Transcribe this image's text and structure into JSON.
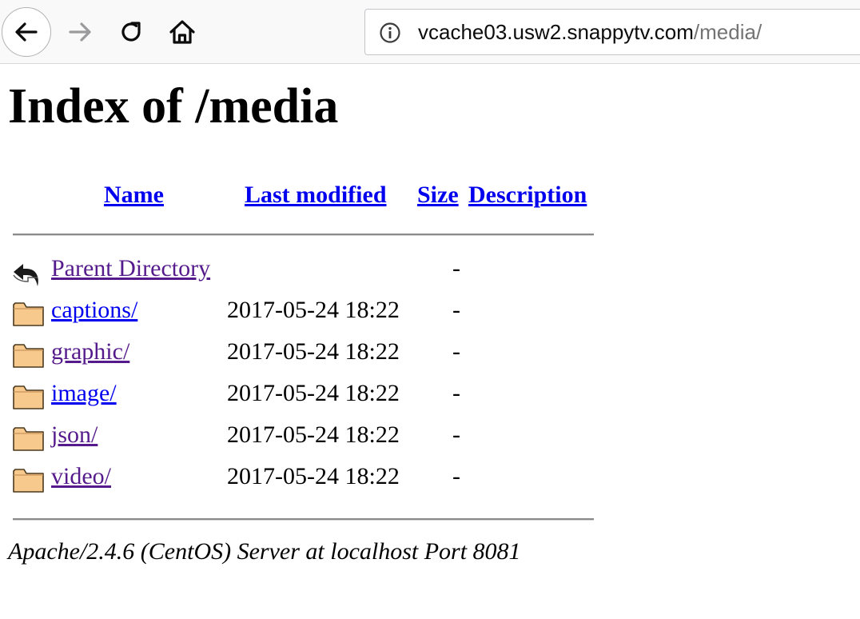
{
  "browser": {
    "url_host": "vcache03.usw2.snappytv.com",
    "url_path": "/media/",
    "icons": {
      "back": "back-arrow-icon",
      "forward": "forward-arrow-icon",
      "reload": "reload-icon",
      "home": "home-icon",
      "site_info": "info-icon"
    }
  },
  "page": {
    "title": "Index of /media",
    "columns": {
      "name": "Name",
      "last_modified": "Last modified",
      "size": "Size",
      "description": "Description"
    },
    "rows": [
      {
        "name": "Parent Directory",
        "last_modified": "",
        "size": "-",
        "description": "",
        "icon": "parent-directory-icon",
        "visited": true
      },
      {
        "name": "captions/",
        "last_modified": "2017-05-24 18:22",
        "size": "-",
        "description": "",
        "icon": "folder-icon",
        "visited": false
      },
      {
        "name": "graphic/",
        "last_modified": "2017-05-24 18:22",
        "size": "-",
        "description": "",
        "icon": "folder-icon",
        "visited": true
      },
      {
        "name": "image/",
        "last_modified": "2017-05-24 18:22",
        "size": "-",
        "description": "",
        "icon": "folder-icon",
        "visited": false
      },
      {
        "name": "json/",
        "last_modified": "2017-05-24 18:22",
        "size": "-",
        "description": "",
        "icon": "folder-icon",
        "visited": true
      },
      {
        "name": "video/",
        "last_modified": "2017-05-24 18:22",
        "size": "-",
        "description": "",
        "icon": "folder-icon",
        "visited": true
      }
    ],
    "server_signature": "Apache/2.4.6 (CentOS) Server at localhost Port 8081"
  },
  "colors": {
    "link": "#0000ee",
    "visited_link": "#551a8b",
    "folder_fill": "#f8c98c",
    "folder_stroke": "#4a3a20"
  }
}
